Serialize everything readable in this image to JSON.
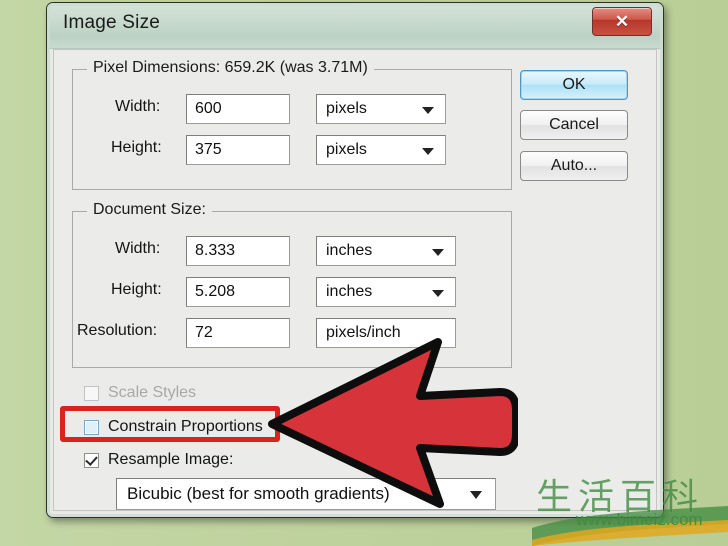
{
  "window": {
    "title": "Image Size",
    "close_icon": "close-x-icon"
  },
  "pixel_dimensions": {
    "legend": "Pixel Dimensions:  659.2K (was 3.71M)",
    "rows": [
      {
        "label": "Width:",
        "value": "600",
        "unit": "pixels",
        "unit_icon": "chevron-down-icon"
      },
      {
        "label": "Height:",
        "value": "375",
        "unit": "pixels",
        "unit_icon": "chevron-down-icon"
      }
    ]
  },
  "document_size": {
    "legend": "Document Size:",
    "rows": [
      {
        "label": "Width:",
        "value": "8.333",
        "unit": "inches",
        "unit_icon": "chevron-down-icon"
      },
      {
        "label": "Height:",
        "value": "5.208",
        "unit": "inches",
        "unit_icon": "chevron-down-icon"
      },
      {
        "label": "Resolution:",
        "value": "72",
        "unit": "pixels/inch",
        "unit_icon": "none"
      }
    ]
  },
  "buttons": {
    "ok": "OK",
    "cancel": "Cancel",
    "auto": "Auto..."
  },
  "options": {
    "scale_styles": {
      "label": "Scale Styles",
      "checked": false,
      "enabled": false
    },
    "constrain_proportions": {
      "label": "Constrain Proportions",
      "checked": false,
      "enabled": true,
      "focused": true
    },
    "resample_image": {
      "label": "Resample Image:",
      "checked": true,
      "enabled": true
    },
    "resample_method": {
      "value": "Bicubic (best for smooth gradients)",
      "icon": "chevron-down-icon"
    }
  },
  "annotations": {
    "arrow": {
      "name": "red-arrow-pointer",
      "color": "#d6343a",
      "outline": "#0d0d0d",
      "points_at": "Constrain Proportions"
    },
    "highlight": {
      "name": "red-highlight-rectangle",
      "color": "#d8231f",
      "target": "Constrain Proportions"
    }
  },
  "watermark": {
    "characters": "生活百科",
    "url": "www.bimeiz.com",
    "color": "#3f8a3f"
  },
  "colors": {
    "desktop_background": "#bed29e",
    "dialog_body": "#ebebe9",
    "titlebar": "#cadbd0",
    "close_button": "#c9503f",
    "default_button": "#aee1f7"
  }
}
